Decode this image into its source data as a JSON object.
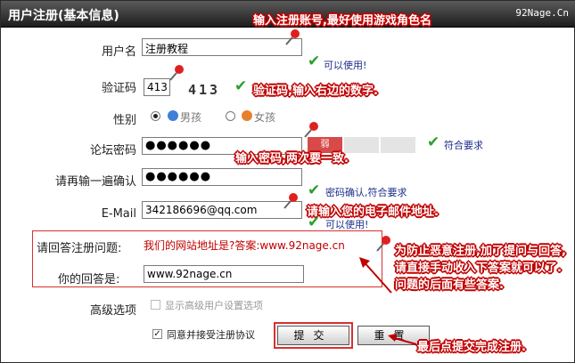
{
  "title": "用户注册(基本信息)",
  "brand": "92Nage.Cn",
  "annotations": {
    "username": "输入注册账号,最好使用游戏角色名",
    "captcha": "验证码,输入右边的数字.",
    "password": "输入密码,两次要一致.",
    "email": "请输入您的电子邮件地址.",
    "qa": "为防止恶意注册,加了提问与回答,请直接手动收入下答案就可以了.问题的后面有些答案.",
    "submit": "最后点提交完成注册."
  },
  "form": {
    "username": {
      "label": "用户名",
      "value": "注册教程",
      "status": "可以使用!"
    },
    "captcha": {
      "label": "验证码",
      "value": "413",
      "image_text": "413"
    },
    "gender": {
      "label": "性别",
      "options": [
        "男孩",
        "女孩"
      ],
      "selected": "男孩"
    },
    "password": {
      "label": "论坛密码",
      "value": "●●●●●●",
      "status": "符合要求",
      "strength_weak": "弱"
    },
    "confirm": {
      "label": "请再输一遍确认",
      "value": "●●●●●●",
      "status": "密码确认,符合要求"
    },
    "email": {
      "label": "E-Mail",
      "value": "342186696@qq.com",
      "status": "可以使用!"
    },
    "question": {
      "label": "请回答注册问题:",
      "text": "我们的网站地址是?答案:www.92nage.cn"
    },
    "answer": {
      "label": "你的回答是:",
      "value": "www.92nage.cn"
    },
    "advanced": {
      "label": "高级选项",
      "option": "显示高级用户设置选项",
      "checked": false
    },
    "agree": {
      "label": "同意并接受注册协议",
      "checked": true
    }
  },
  "buttons": {
    "submit": "提交",
    "reset": "重置"
  },
  "colors": {
    "annotation": "#c00000",
    "ok_text": "#1c2d8a",
    "check": "#2aa02a",
    "highlight_border": "#d83030"
  }
}
